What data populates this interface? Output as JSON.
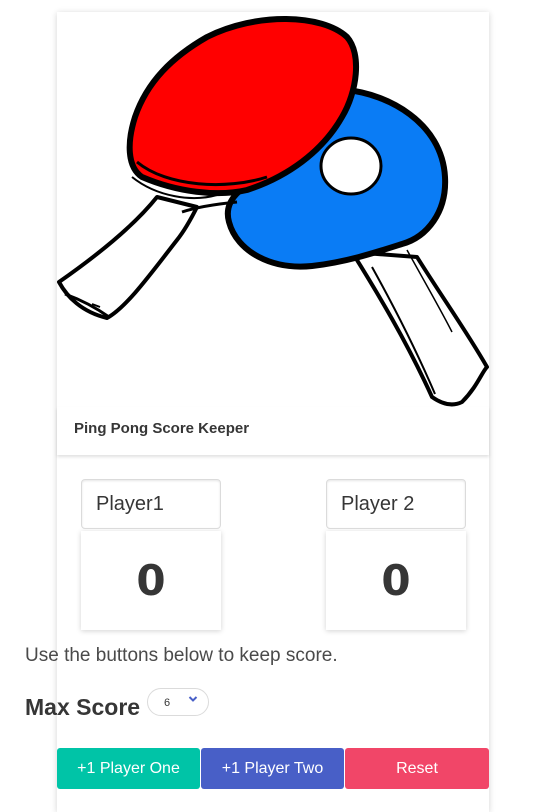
{
  "app": {
    "title": "Ping Pong Score Keeper",
    "image_icon": "ping-pong-paddles-illustration"
  },
  "players": [
    {
      "name_value": "Player1",
      "score": "0"
    },
    {
      "name_value": "Player 2",
      "score": "0"
    }
  ],
  "instructions": "Use the buttons below to keep score.",
  "max_score": {
    "label": "Max Score",
    "selected": "6"
  },
  "buttons": {
    "player_one": "+1 Player One",
    "player_two": "+1 Player Two",
    "reset": "Reset"
  },
  "colors": {
    "player_one_button": "#00c4a7",
    "player_two_button": "#485fc7",
    "reset_button": "#f14668",
    "paddle_red": "#ff0000",
    "paddle_blue": "#0a7cf5",
    "select_arrow": "#485fc7"
  }
}
